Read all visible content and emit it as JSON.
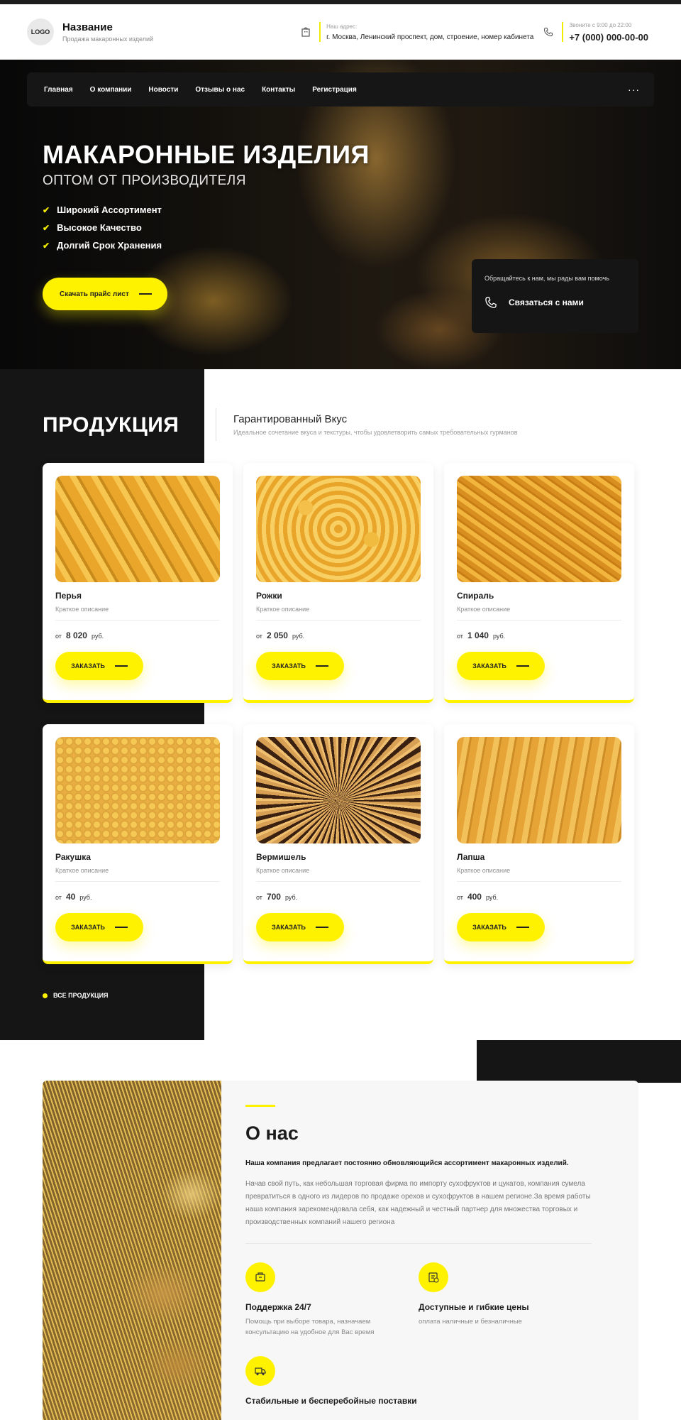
{
  "header": {
    "logo": "LOGO",
    "title": "Название",
    "subtitle": "Продажа макаронных изделий",
    "address_label": "Наш адрес:",
    "address": "г. Москва, Ленинский проспект, дом, строение, номер кабинета",
    "phone_label": "Звоните с 9:00 до 22:00",
    "phone": "+7 (000) 000-00-00"
  },
  "nav": {
    "items": [
      "Главная",
      "О компании",
      "Новости",
      "Отзывы о нас",
      "Контакты",
      "Регистрация"
    ],
    "more": "···"
  },
  "hero": {
    "title": "МАКАРОННЫЕ ИЗДЕЛИЯ",
    "subtitle": "ОПТОМ ОТ ПРОИЗВОДИТЕЛЯ",
    "features": [
      "Широкий Ассортимент",
      "Высокое Качество",
      "Долгий Срок Хранения"
    ],
    "button": "Скачать прайс лист",
    "call_question": "Обращайтесь к нам, мы рады вам помочь",
    "call_label": "Связаться с нами"
  },
  "products": {
    "title": "ПРОДУКЦИЯ",
    "subtitle": "Гарантированный Вкус",
    "description": "Идеальное сочетание вкуса и текстуры, чтобы удовлетворить самых требовательных гурманов",
    "price_prefix": "от",
    "currency": "руб.",
    "order_label": "ЗАКАЗАТЬ",
    "all_label": "ВСЕ ПРОДУКЦИЯ",
    "items": [
      {
        "name": "Перья",
        "desc": "Краткое описание",
        "price": "8 020"
      },
      {
        "name": "Рожки",
        "desc": "Краткое описание",
        "price": "2 050"
      },
      {
        "name": "Спираль",
        "desc": "Краткое описание",
        "price": "1 040"
      },
      {
        "name": "Ракушка",
        "desc": "Краткое описание",
        "price": "40"
      },
      {
        "name": "Вермишель",
        "desc": "Краткое описание",
        "price": "700"
      },
      {
        "name": "Лапша",
        "desc": "Краткое описание",
        "price": "400"
      }
    ]
  },
  "about": {
    "title": "О нас",
    "lead": "Наша компания предлагает постоянно обновляющийся ассортимент макаронных изделий.",
    "text": "Начав свой путь, как небольшая торговая фирма по импорту сухофруктов и цукатов, компания сумела превратиться в одного из лидеров по продаже орехов и сухофруктов в нашем регионе.За время работы наша компания зарекомендовала себя, как надежный и честный партнер для множества торговых и производственных компаний нашего региона",
    "features": [
      {
        "title": "Поддержка 24/7",
        "desc": "Помощь при выборе товара, назначаем консультацию на удобное для Вас время"
      },
      {
        "title": "Доступные и гибкие цены",
        "desc": "оплата наличные и безналичные"
      },
      {
        "title": "Стабильные и бесперебойные поставки",
        "desc": ""
      }
    ]
  },
  "colors": {
    "accent": "#fff200",
    "dark": "#151515"
  }
}
